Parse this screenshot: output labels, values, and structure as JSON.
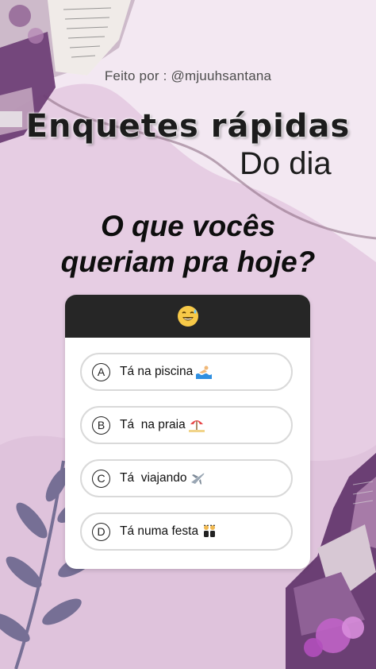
{
  "story": {
    "credit": "Feito por : @mjuuhsantana",
    "title": "Enquetes rápidas",
    "subtitle": "Do dia",
    "question_line1": "O que vocês",
    "question_line2": "queriam pra hoje?"
  },
  "quiz": {
    "header_icon": "grinning-sweat-emoji-icon",
    "options": [
      {
        "letter": "A",
        "label": "Tá na piscina",
        "icon": "swimmer-icon"
      },
      {
        "letter": "B",
        "label": "Tá  na praia",
        "icon": "beach-umbrella-icon"
      },
      {
        "letter": "C",
        "label": "Tá  viajando",
        "icon": "airplane-icon"
      },
      {
        "letter": "D",
        "label": "Tá numa festa",
        "icon": "dancers-icon"
      }
    ]
  },
  "colors": {
    "background": "#e6cde3",
    "card_header": "#262626",
    "option_border": "#d9d9d9",
    "accent_purple": "#7a4f86"
  }
}
